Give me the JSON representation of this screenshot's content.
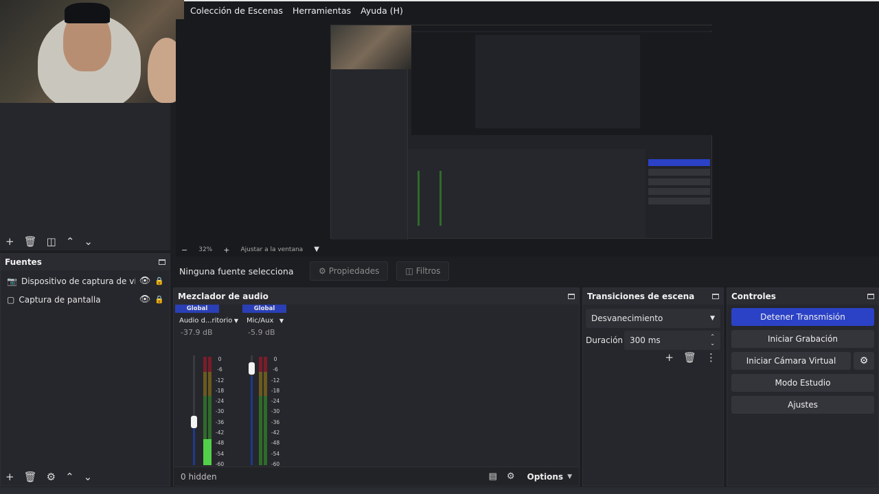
{
  "menu": [
    "Colección de Escenas",
    "Herramientas",
    "Ayuda (H)"
  ],
  "zoom": {
    "value": "32%",
    "fit": "Ajustar a la ventana"
  },
  "sources": {
    "title": "Fuentes",
    "items": [
      {
        "label": "Dispositivo de captura de vídeo",
        "icon": "camera-icon"
      },
      {
        "label": "Captura de pantalla",
        "icon": "monitor-icon"
      }
    ]
  },
  "source_bar": {
    "none": "Ninguna fuente selecciona",
    "properties": "Propiedades",
    "filters": "Filtros"
  },
  "mixer": {
    "title": "Mezclador de audio",
    "channels": [
      {
        "header": "Global",
        "name": "Audio d...ritorio",
        "db": "-37.9 dB",
        "level": 0.23
      },
      {
        "header": "Global",
        "name": "Mic/Aux",
        "db": "-5.9 dB",
        "level": 0.82
      }
    ],
    "ticks": [
      "0",
      "-6",
      "-12",
      "-18",
      "-24",
      "-30",
      "-36",
      "-42",
      "-48",
      "-54",
      "-60"
    ],
    "hidden": "0 hidden",
    "options": "Options"
  },
  "transitions": {
    "title": "Transiciones de escena",
    "selected": "Desvanecimiento",
    "duration_label": "Duración",
    "duration": "300 ms"
  },
  "controls": {
    "title": "Controles",
    "stop_stream": "Detener Transmisión",
    "start_record": "Iniciar Grabación",
    "virtual_cam": "Iniciar Cámara Virtual",
    "studio": "Modo Estudio",
    "settings": "Ajustes"
  },
  "colors": {
    "accent": "#2b42c6",
    "channel_header": "#2a3fb5",
    "panel": "#26272c"
  }
}
